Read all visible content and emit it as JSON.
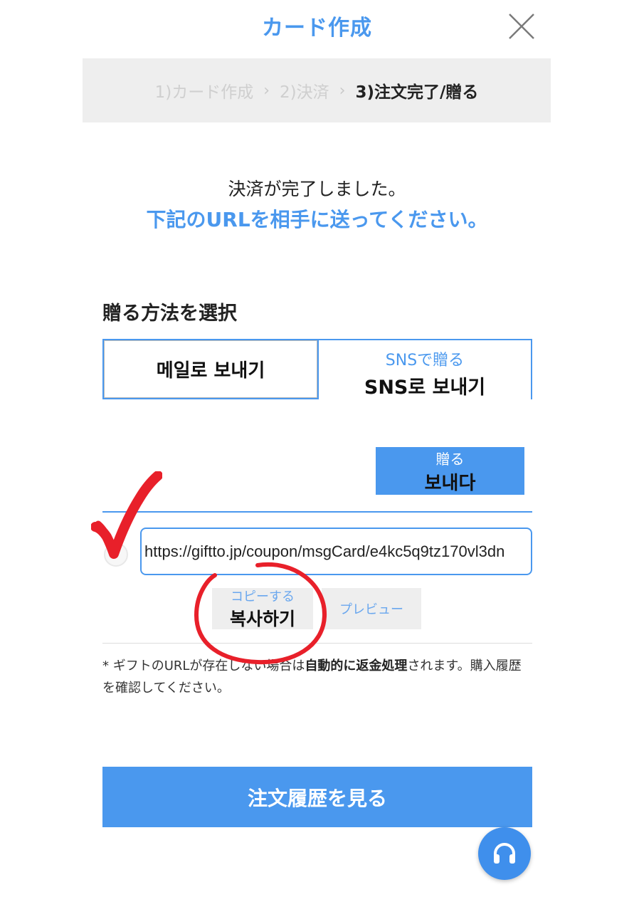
{
  "header": {
    "title": "カード作成"
  },
  "steps": [
    {
      "label": "1)カード作成"
    },
    {
      "label": "2)決済"
    },
    {
      "label": "3)注文完了/贈る"
    }
  ],
  "message": {
    "line1": "決済が完了しました。",
    "line2": "下記のURLを相手に送ってください。"
  },
  "send_method": {
    "title": "贈る方法を選択",
    "tab_mail_label": "메일로 보내기",
    "tab_sns_label": "SNSで贈る",
    "tab_sns_annotation": "SNS로 보내기"
  },
  "send_button": {
    "label": "贈る",
    "annotation": "보내다"
  },
  "url_field": {
    "value": "https://giftto.jp/coupon/msgCard/e4kc5q9tz170vl3dn"
  },
  "copy_button": {
    "label": "コピーする",
    "annotation": "복사하기"
  },
  "preview_button": {
    "label": "プレビュー"
  },
  "notice": {
    "prefix": "* ギフトのURLが存在しない場合は",
    "bold": "自動的に返金処理",
    "suffix": "されます。購入履歴を確認してください。"
  },
  "history_button": {
    "label": "注文履歴を見る"
  },
  "colors": {
    "accent": "#4a98ee",
    "annotation_red": "#e8202a"
  },
  "icons": {
    "close": "close-icon",
    "chevron": "chevron-right-icon",
    "support": "headset-icon"
  }
}
